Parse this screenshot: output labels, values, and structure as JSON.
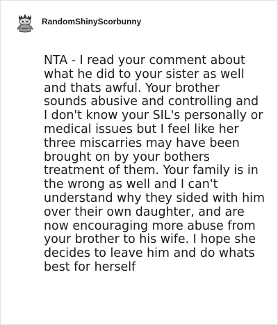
{
  "comment": {
    "author": "RandomShinyScorbunny",
    "body": "NTA - I read your comment about what he did to your sister as well and thats awful. Your brother sounds abusive and controlling and I don't know your SIL's personally or medical issues but I feel like her three miscarries may have been brought on by your bothers treatment of them. Your family is in the wrong as well and I can't understand why they sided with him over their own daughter, and are now encouraging more abuse from your brother to his wife. I hope she decides to leave him and do whats best for herself",
    "avatar_icon": "snoo-avatar-icon"
  },
  "colors": {
    "text": "#1a1a1b",
    "username": "#1c1c1c",
    "border": "#e2e2e2",
    "background": "#ffffff"
  }
}
